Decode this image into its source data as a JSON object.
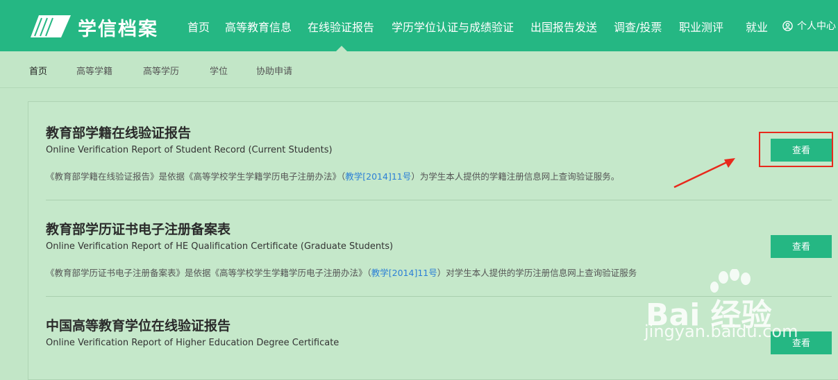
{
  "brand": {
    "name": "学信档案"
  },
  "topnav": {
    "items": [
      "首页",
      "高等教育信息",
      "在线验证报告",
      "学历学位认证与成绩验证",
      "出国报告发送",
      "调查/投票",
      "职业测评",
      "就业"
    ],
    "active": "在线验证报告",
    "user_center": "个人中心"
  },
  "subnav": {
    "items": [
      "首页",
      "高等学籍",
      "高等学历",
      "学位",
      "协助申请"
    ],
    "active": "首页"
  },
  "entries": [
    {
      "title": "教育部学籍在线验证报告",
      "english": "Online Verification Report of Student Record (Current Students)",
      "desc_before": "《教育部学籍在线验证报告》是依据《高等学校学生学籍学历电子注册办法》（",
      "desc_link": "教学[2014]11号",
      "desc_after": "）为学生本人提供的学籍注册信息网上查询验证服务。",
      "button": "查看"
    },
    {
      "title": "教育部学历证书电子注册备案表",
      "english": "Online Verification Report of HE Qualification Certificate (Graduate Students)",
      "desc_before": "《教育部学历证书电子注册备案表》是依据《高等学校学生学籍学历电子注册办法》（",
      "desc_link": "教学[2014]11号",
      "desc_after": "）对学生本人提供的学历注册信息网上查询验证服务",
      "button": "查看"
    },
    {
      "title": "中国高等教育学位在线验证报告",
      "english": "Online Verification Report of Higher Education Degree Certificate",
      "button": "查看"
    }
  ],
  "watermark": {
    "brand": "Bai 经验",
    "url": "jingyan.baidu.com"
  },
  "colors": {
    "primary": "#25b783",
    "background": "#c2e6c7",
    "annotation": "#e8291c",
    "link": "#2b7fd6"
  }
}
